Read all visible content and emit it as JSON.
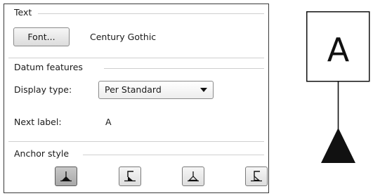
{
  "text_group": {
    "title": "Text",
    "font_button_label": "Font...",
    "font_name": "Century Gothic"
  },
  "datum_group": {
    "title": "Datum features",
    "display_type_label": "Display type:",
    "display_type_value": "Per Standard",
    "next_label_label": "Next label:",
    "next_label_value": "A"
  },
  "anchor_group": {
    "title": "Anchor style",
    "options": [
      {
        "icon": "anchor-filled-triangle-icon",
        "selected": true
      },
      {
        "icon": "anchor-flag-icon",
        "selected": false
      },
      {
        "icon": "anchor-open-triangle-icon",
        "selected": false
      },
      {
        "icon": "anchor-open-flag-icon",
        "selected": false
      }
    ]
  },
  "preview": {
    "label": "A"
  }
}
